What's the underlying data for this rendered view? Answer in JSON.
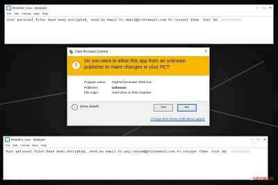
{
  "notepad_top": {
    "title": "Readme_now - Notepad",
    "menu": [
      "File",
      "Edit",
      "Format",
      "View",
      "Help"
    ],
    "text": "Your personal files have been encrypted, send an email to email@protonmail.com to recover them. Your ID: ",
    "id_blurred": "d8th0de4dd"
  },
  "notepad_bottom": {
    "title": "Readme_now - Notepad",
    "menu": [
      "File",
      "Edit",
      "Format",
      "View",
      "Help"
    ],
    "text": "Your personal files have been encrypted, send an email to pay.ransom@protonmail.com to recover them. Your ID: ",
    "id_blurred": "7d4beb4fd4"
  },
  "uac": {
    "title": "User Account Control",
    "close": "×",
    "question": "Do you want to allow this app from an unknown publisher to make changes to your PC?",
    "program_name_label": "Program name:",
    "program_name_value": "PayPal-Generator-2019.exe",
    "publisher_label": "Publisher:",
    "publisher_value": "Unknown",
    "file_origin_label": "File origin:",
    "file_origin_value": "Hard drive on this computer",
    "show_details": "Show details",
    "yes": "Yes",
    "no": "No",
    "change_link": "Change when these notifications appear",
    "banner_color": "#f5b700"
  },
  "watermark": {
    "part1": "2",
    "part2": "SPYWAR"
  }
}
